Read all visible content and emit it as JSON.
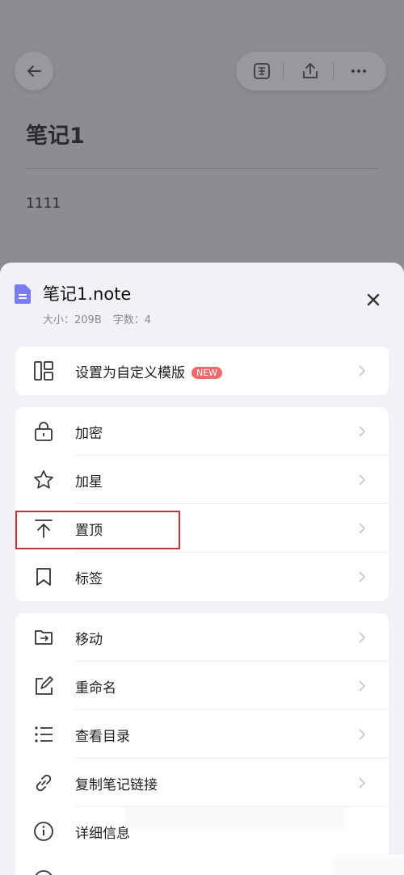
{
  "note": {
    "title": "笔记1",
    "body": "1111",
    "toolbar": {
      "translate_icon": "translate-icon",
      "share_icon": "share-icon",
      "more_icon": "more-icon"
    }
  },
  "sheet": {
    "file_name": "笔记1.note",
    "size": "大小：209B",
    "word_count": "字数：4",
    "badge_new": "NEW",
    "group1": [
      {
        "label": "设置为自定义模版",
        "icon": "template-layout-icon"
      }
    ],
    "group2": [
      {
        "label": "加密",
        "icon": "lock-icon"
      },
      {
        "label": "加星",
        "icon": "star-icon"
      },
      {
        "label": "置顶",
        "icon": "pin-top-icon"
      },
      {
        "label": "标签",
        "icon": "bookmark-icon"
      }
    ],
    "group3": [
      {
        "label": "移动",
        "icon": "move-folder-icon"
      },
      {
        "label": "重命名",
        "icon": "rename-icon"
      },
      {
        "label": "查看目录",
        "icon": "list-icon"
      },
      {
        "label": "复制笔记链接",
        "icon": "link-icon"
      },
      {
        "label": "详细信息",
        "icon": "info-icon"
      }
    ]
  },
  "colors": {
    "accent_badge": "#ef6a6a",
    "highlight_border": "#c0343a",
    "sheet_bg": "#f2f2f6",
    "overlay": "#8e8c91"
  }
}
